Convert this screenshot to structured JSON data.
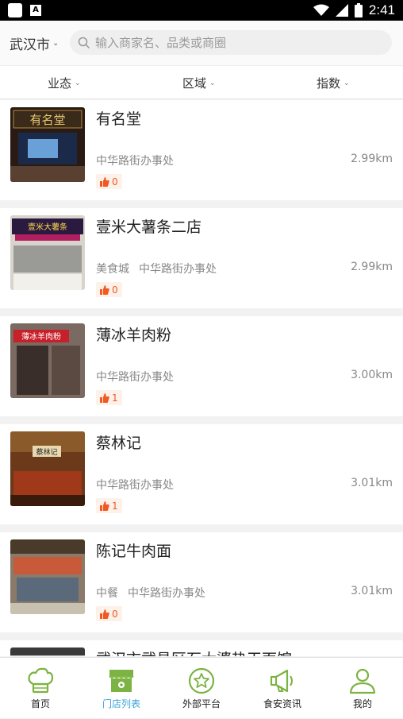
{
  "status_bar": {
    "time": "2:41"
  },
  "header": {
    "city": "武汉市",
    "search_placeholder": "输入商家名、品类或商圈"
  },
  "filters": [
    {
      "label": "业态"
    },
    {
      "label": "区域"
    },
    {
      "label": "指数"
    }
  ],
  "stores": [
    {
      "name": "有名堂",
      "category": "",
      "area": "中华路街办事处",
      "distance": "2.99km",
      "likes": "0"
    },
    {
      "name": "壹米大薯条二店",
      "category": "美食城",
      "area": "中华路街办事处",
      "distance": "2.99km",
      "likes": "0"
    },
    {
      "name": "薄冰羊肉粉",
      "category": "",
      "area": "中华路街办事处",
      "distance": "3.00km",
      "likes": "1"
    },
    {
      "name": "蔡林记",
      "category": "",
      "area": "中华路街办事处",
      "distance": "3.01km",
      "likes": "1"
    },
    {
      "name": "陈记牛肉面",
      "category": "中餐",
      "area": "中华路街办事处",
      "distance": "3.01km",
      "likes": "0"
    },
    {
      "name": "武汉市武昌区石大婆热干面馆",
      "category": "",
      "area": "",
      "distance": "",
      "likes": ""
    }
  ],
  "tabs": [
    {
      "label": "首页",
      "icon": "chef-hat-icon",
      "active": false
    },
    {
      "label": "门店列表",
      "icon": "storefront-icon",
      "active": true
    },
    {
      "label": "外部平台",
      "icon": "star-circle-icon",
      "active": false
    },
    {
      "label": "食安资讯",
      "icon": "megaphone-icon",
      "active": false
    },
    {
      "label": "我的",
      "icon": "user-icon",
      "active": false
    }
  ],
  "colors": {
    "accent_green": "#7cb342",
    "active_blue": "#3aa3d8",
    "like_orange": "#f05a22"
  }
}
